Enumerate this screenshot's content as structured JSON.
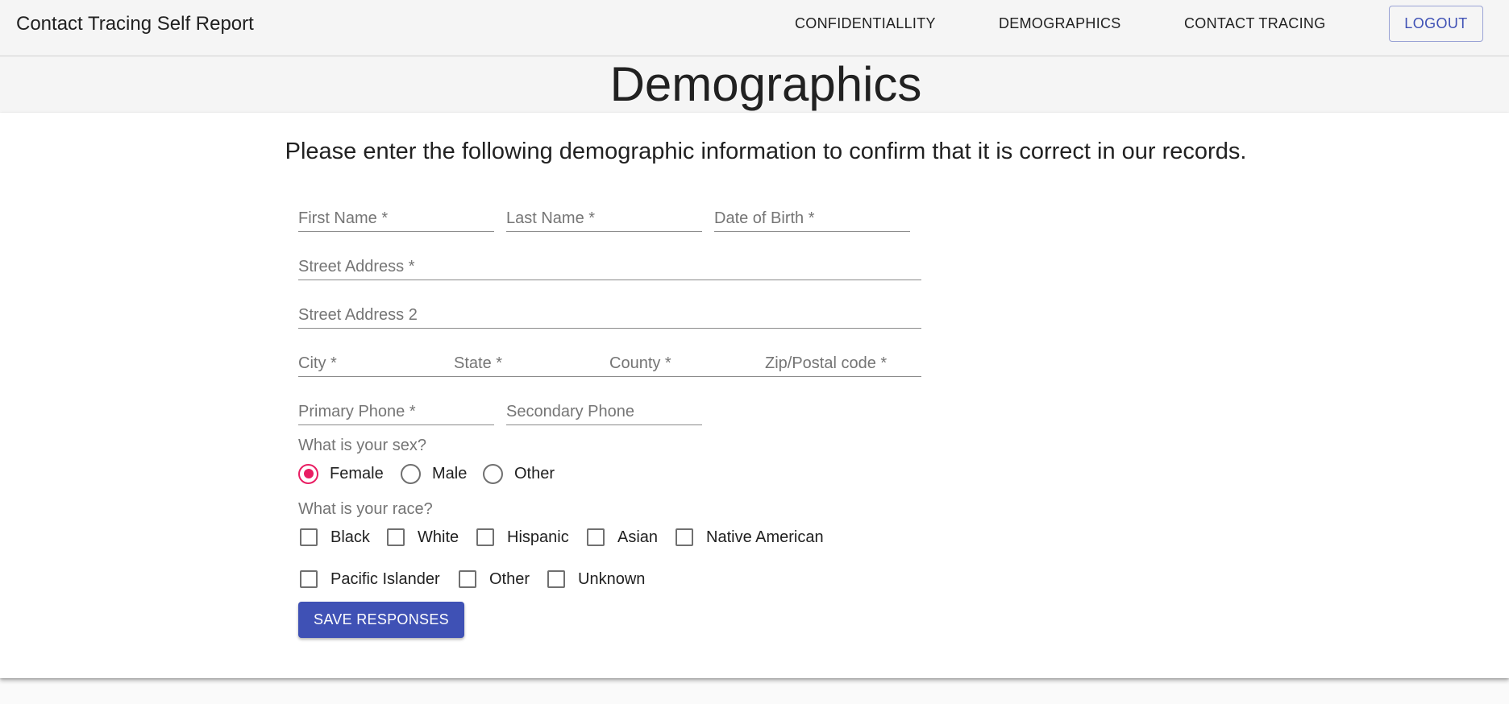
{
  "header": {
    "app_title": "Contact Tracing Self Report",
    "nav": [
      "CONFIDENTIALLITY",
      "DEMOGRAPHICS",
      "CONTACT TRACING"
    ],
    "logout_label": "LOGOUT"
  },
  "page": {
    "title": "Demographics",
    "intro": "Please enter the following demographic information to confirm that it is correct in our records."
  },
  "form": {
    "first_name": {
      "placeholder": "First Name *",
      "value": ""
    },
    "last_name": {
      "placeholder": "Last Name *",
      "value": ""
    },
    "dob": {
      "placeholder": "Date of Birth *",
      "value": ""
    },
    "street1": {
      "placeholder": "Street Address *",
      "value": ""
    },
    "street2": {
      "placeholder": "Street Address 2",
      "value": ""
    },
    "city": {
      "placeholder": "City *",
      "value": ""
    },
    "state": {
      "placeholder": "State *",
      "value": ""
    },
    "county": {
      "placeholder": "County *",
      "value": ""
    },
    "zip": {
      "placeholder": "Zip/Postal code *",
      "value": ""
    },
    "primary_phone": {
      "placeholder": "Primary Phone *",
      "value": ""
    },
    "secondary_phone": {
      "placeholder": "Secondary Phone",
      "value": ""
    },
    "sex": {
      "question": "What is your sex?",
      "options": [
        "Female",
        "Male",
        "Other"
      ],
      "selected": "Female"
    },
    "race": {
      "question": "What is your race?",
      "options": [
        "Black",
        "White",
        "Hispanic",
        "Asian",
        "Native American",
        "Pacific Islander",
        "Other",
        "Unknown"
      ],
      "checked": []
    },
    "save_label": "SAVE RESPONSES"
  },
  "colors": {
    "primary": "#3f51b5",
    "radio_accent": "#e91e63"
  }
}
